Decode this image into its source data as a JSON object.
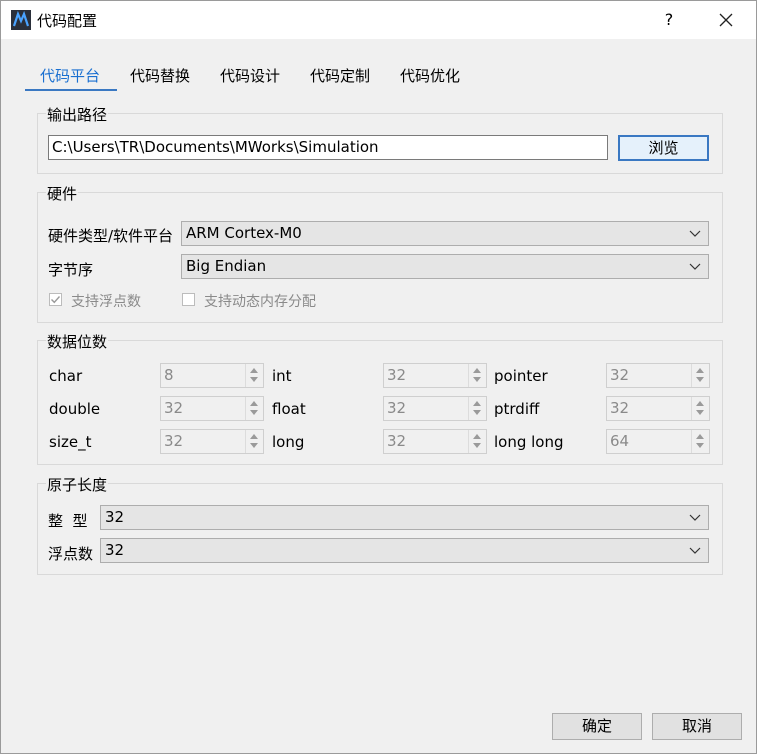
{
  "window": {
    "title": "代码配置",
    "help_label": "?",
    "icon": "mworks-logo-icon"
  },
  "tabs": [
    {
      "label": "代码平台",
      "active": true
    },
    {
      "label": "代码替换",
      "active": false
    },
    {
      "label": "代码设计",
      "active": false
    },
    {
      "label": "代码定制",
      "active": false
    },
    {
      "label": "代码优化",
      "active": false
    }
  ],
  "output_path": {
    "title": "输出路径",
    "value": "C:\\Users\\TR\\Documents\\MWorks\\Simulation",
    "browse_label": "浏览"
  },
  "hardware": {
    "title": "硬件",
    "platform_label": "硬件类型/软件平台",
    "platform_value": "ARM Cortex-M0",
    "byte_order_label": "字节序",
    "byte_order_value": "Big Endian",
    "float_support_label": "支持浮点数",
    "float_support_checked": true,
    "dynamic_mem_label": "支持动态内存分配",
    "dynamic_mem_checked": false
  },
  "data_bits": {
    "title": "数据位数",
    "fields": [
      {
        "label": "char",
        "value": "8"
      },
      {
        "label": "int",
        "value": "32"
      },
      {
        "label": "pointer",
        "value": "32"
      },
      {
        "label": "double",
        "value": "32"
      },
      {
        "label": "float",
        "value": "32"
      },
      {
        "label": "ptrdiff",
        "value": "32"
      },
      {
        "label": "size_t",
        "value": "32"
      },
      {
        "label": "long",
        "value": "32"
      },
      {
        "label": "long long",
        "value": "64"
      }
    ]
  },
  "atomic_length": {
    "title": "原子长度",
    "integer_label": "整  型",
    "integer_value": "32",
    "float_label": "浮点数",
    "float_value": "32"
  },
  "footer": {
    "ok_label": "确定",
    "cancel_label": "取消"
  },
  "colors": {
    "accent": "#3a78c2",
    "active_tab": "#1a6fd0"
  }
}
